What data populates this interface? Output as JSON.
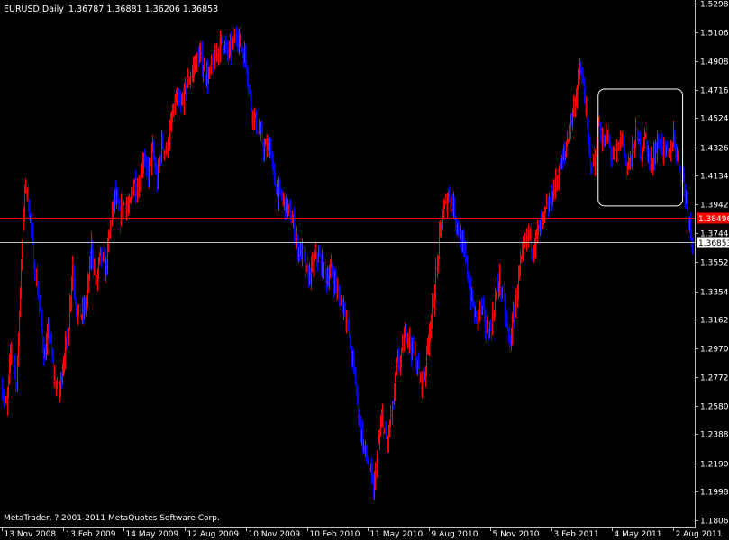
{
  "window": {
    "symbol_label": "EURUSD,Daily",
    "ohlc_readout": "1.36787 1.36881 1.36206 1.36853",
    "copyright": "MetaTrader, ? 2001-2011 MetaQuotes Software Corp."
  },
  "colors": {
    "background": "#000000",
    "bull": "#ff0000",
    "bear": "#0000ff",
    "axis": "#c0c0c0",
    "text": "#ffffff",
    "ask_line": "#ff0000",
    "bid_line": "#c0c0c0",
    "ask_badge": "#ff0000",
    "bid_badge": "#ffffff"
  },
  "chart_data": {
    "type": "bar",
    "style": "ohlc",
    "symbol": "EURUSD",
    "timeframe": "Daily",
    "ylim": [
      1.1806,
      1.5298
    ],
    "y_ticks": [
      "1.52980",
      "1.51060",
      "1.49080",
      "1.47160",
      "1.45240",
      "1.43260",
      "1.41340",
      "1.39420",
      "1.37440",
      "1.35520",
      "1.33540",
      "1.31620",
      "1.29700",
      "1.27720",
      "1.25800",
      "1.23880",
      "1.21900",
      "1.19980",
      "1.18060"
    ],
    "x_ticks": [
      "13 Nov 2008",
      "13 Feb 2009",
      "14 May 2009",
      "12 Aug 2009",
      "10 Nov 2009",
      "10 Feb 2010",
      "11 May 2010",
      "9 Aug 2010",
      "5 Nov 2010",
      "3 Feb 2011",
      "4 May 2011",
      "2 Aug 2011"
    ],
    "x_tick_index": [
      0,
      13,
      26,
      39,
      52,
      65,
      78,
      91,
      104,
      117,
      130,
      143
    ],
    "weekly_close_path": [
      1.27,
      1.256,
      1.3,
      1.27,
      1.355,
      1.41,
      1.385,
      1.35,
      1.32,
      1.29,
      1.31,
      1.28,
      1.265,
      1.29,
      1.305,
      1.355,
      1.32,
      1.32,
      1.33,
      1.365,
      1.34,
      1.36,
      1.35,
      1.38,
      1.4,
      1.385,
      1.395,
      1.39,
      1.41,
      1.405,
      1.425,
      1.415,
      1.43,
      1.41,
      1.435,
      1.43,
      1.45,
      1.465,
      1.46,
      1.47,
      1.48,
      1.49,
      1.495,
      1.485,
      1.48,
      1.49,
      1.5,
      1.505,
      1.495,
      1.5,
      1.51,
      1.5,
      1.49,
      1.46,
      1.45,
      1.44,
      1.43,
      1.435,
      1.41,
      1.4,
      1.395,
      1.39,
      1.38,
      1.365,
      1.36,
      1.345,
      1.35,
      1.36,
      1.355,
      1.345,
      1.35,
      1.34,
      1.33,
      1.325,
      1.3,
      1.28,
      1.25,
      1.23,
      1.22,
      1.2,
      1.23,
      1.25,
      1.23,
      1.255,
      1.285,
      1.29,
      1.31,
      1.3,
      1.29,
      1.275,
      1.28,
      1.31,
      1.33,
      1.37,
      1.39,
      1.4,
      1.395,
      1.38,
      1.365,
      1.35,
      1.33,
      1.315,
      1.325,
      1.31,
      1.31,
      1.33,
      1.345,
      1.32,
      1.3,
      1.32,
      1.345,
      1.36,
      1.375,
      1.365,
      1.375,
      1.38,
      1.39,
      1.4,
      1.41,
      1.42,
      1.43,
      1.45,
      1.465,
      1.485,
      1.47,
      1.43,
      1.42,
      1.45,
      1.435,
      1.44,
      1.425,
      1.43,
      1.44,
      1.42,
      1.425,
      1.44,
      1.43,
      1.44,
      1.42,
      1.43,
      1.435,
      1.43,
      1.425,
      1.44,
      1.425,
      1.41,
      1.39,
      1.3685
    ],
    "last_close": 1.36853,
    "ask_line": 1.38496,
    "bid_line": 1.36853,
    "ask_label": "1.38496",
    "bid_label": "1.36853",
    "highlight_box": {
      "x_range": [
        127,
        145
      ],
      "y_range": [
        1.393,
        1.472
      ]
    }
  }
}
